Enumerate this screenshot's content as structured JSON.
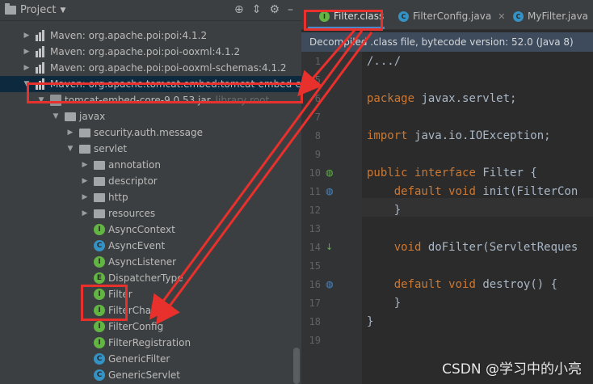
{
  "project_panel": {
    "title": "Project",
    "header_icons": [
      "crosshair-icon",
      "collapse-icon",
      "gear-icon",
      "hide-icon"
    ],
    "tree": [
      {
        "label": "Maven: org.apache.poi:poi:4.1.2",
        "type": "library"
      },
      {
        "label": "Maven: org.apache.poi:poi-ooxml:4.1.2",
        "type": "library"
      },
      {
        "label": "Maven: org.apache.poi:poi-ooxml-schemas:4.1.2",
        "type": "library"
      },
      {
        "label": "Maven: org.apache.tomcat.embed:tomcat-embed-core",
        "type": "library",
        "selected": true
      },
      {
        "label": "tomcat-embed-core-9.0.53.jar",
        "suffix": "library root",
        "type": "jar"
      },
      {
        "label": "javax",
        "type": "package"
      },
      {
        "label": "security.auth.message",
        "type": "package"
      },
      {
        "label": "servlet",
        "type": "package"
      },
      {
        "label": "annotation",
        "type": "package"
      },
      {
        "label": "descriptor",
        "type": "package"
      },
      {
        "label": "http",
        "type": "package"
      },
      {
        "label": "resources",
        "type": "package"
      },
      {
        "label": "AsyncContext",
        "type": "interface"
      },
      {
        "label": "AsyncEvent",
        "type": "class"
      },
      {
        "label": "AsyncListener",
        "type": "interface"
      },
      {
        "label": "DispatcherType",
        "type": "enum"
      },
      {
        "label": "Filter",
        "type": "interface"
      },
      {
        "label": "FilterChain",
        "type": "interface"
      },
      {
        "label": "FilterConfig",
        "type": "interface"
      },
      {
        "label": "FilterRegistration",
        "type": "interface"
      },
      {
        "label": "GenericFilter",
        "type": "class"
      },
      {
        "label": "GenericServlet",
        "type": "class"
      }
    ]
  },
  "editor": {
    "tabs": [
      {
        "label": "Filter.class",
        "active": true,
        "icon": "I"
      },
      {
        "label": "FilterConfig.java",
        "active": false,
        "icon": "C"
      },
      {
        "label": "MyFilter.java",
        "active": false,
        "icon": "C"
      }
    ],
    "info_bar": "Decompiled .class file, bytecode version: 52.0 (Java 8)",
    "lines": [
      {
        "num": "1",
        "text": "/.../"
      },
      {
        "num": "5",
        "text": ""
      },
      {
        "num": "6",
        "text": "package javax.servlet;"
      },
      {
        "num": "7",
        "text": ""
      },
      {
        "num": "8",
        "text": "import java.io.IOException;"
      },
      {
        "num": "9",
        "text": ""
      },
      {
        "num": "10",
        "text": "public interface Filter {"
      },
      {
        "num": "11",
        "text": "    default void init(FilterCon"
      },
      {
        "num": "12",
        "text": "    }"
      },
      {
        "num": "13",
        "text": ""
      },
      {
        "num": "14",
        "text": "    void doFilter(ServletReques"
      },
      {
        "num": "15",
        "text": ""
      },
      {
        "num": "16",
        "text": "    default void destroy() {"
      },
      {
        "num": "17",
        "text": "    }"
      },
      {
        "num": "18",
        "text": "}"
      },
      {
        "num": "19",
        "text": ""
      }
    ]
  },
  "colors": {
    "accent": "#4a88c7",
    "annotation_red": "#e8302c",
    "selection": "#0d293e"
  },
  "watermark": "CSDN @学习中的小亮"
}
